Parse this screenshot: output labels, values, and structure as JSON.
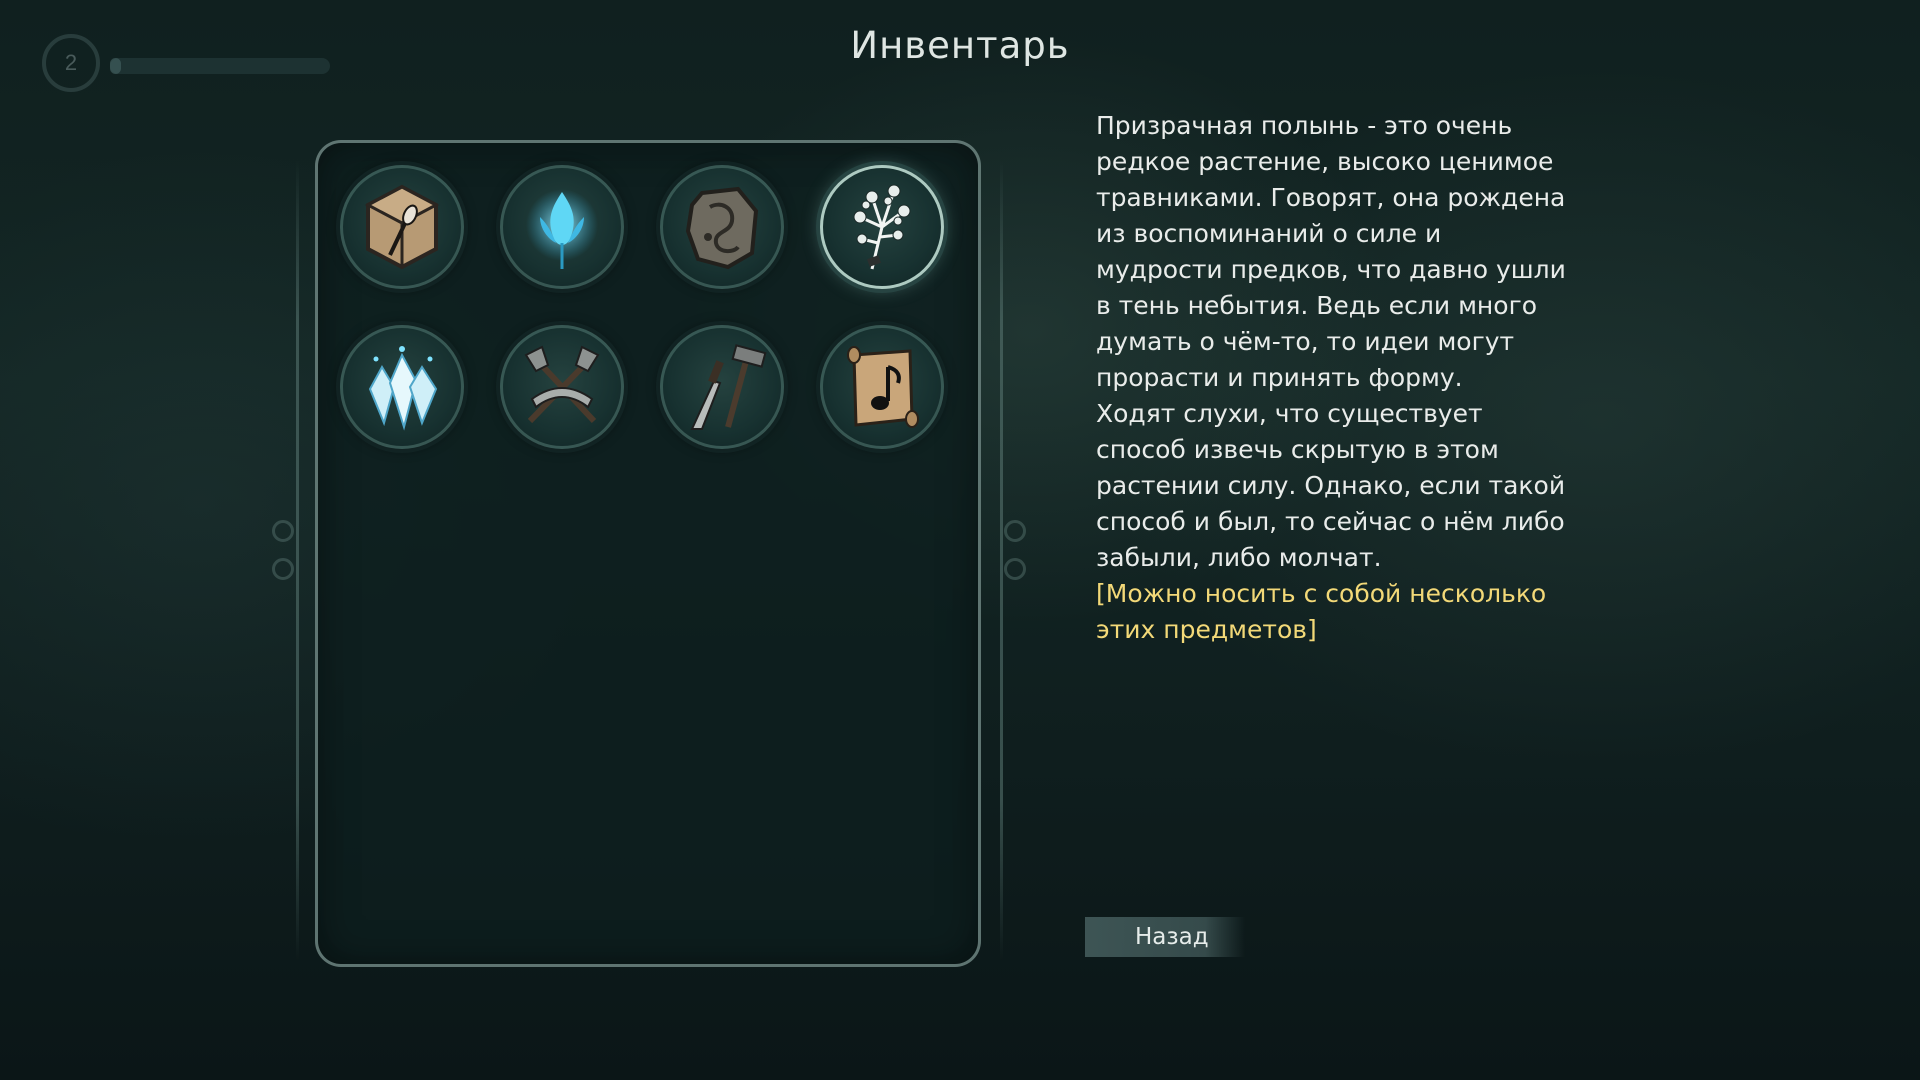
{
  "hud": {
    "level": "2",
    "xp_progress": 0.05
  },
  "title": "Инвентарь",
  "inventory": {
    "items": [
      {
        "icon": "tinder-pouch-icon"
      },
      {
        "icon": "blue-flame-flower-icon"
      },
      {
        "icon": "carved-stone-icon"
      },
      {
        "icon": "ghost-wormwood-icon",
        "selected": true
      },
      {
        "icon": "ice-crystals-icon"
      },
      {
        "icon": "crossed-axes-and-saw-icon"
      },
      {
        "icon": "knife-and-hammer-icon"
      },
      {
        "icon": "music-scroll-icon"
      }
    ]
  },
  "description": {
    "main": "Призрачная полынь - это очень редкое растение, высоко ценимое травниками. Говорят, она рождена из воспоминаний о силе и мудрости предков, что давно ушли в тень небытия. Ведь если много думать о чём-то, то идеи могут прорасти и принять форму.",
    "second": "Ходят слухи, что существует способ извечь скрытую в этом растении силу. Однако, если такой способ и был, то сейчас о нём либо забыли, либо молчат.",
    "note": "[Можно носить с собой несколько этих предметов]"
  },
  "buttons": {
    "back": "Назад"
  },
  "colors": {
    "note": "#f3d978",
    "text": "#e9ecea",
    "panel_border": "#96afaa"
  }
}
